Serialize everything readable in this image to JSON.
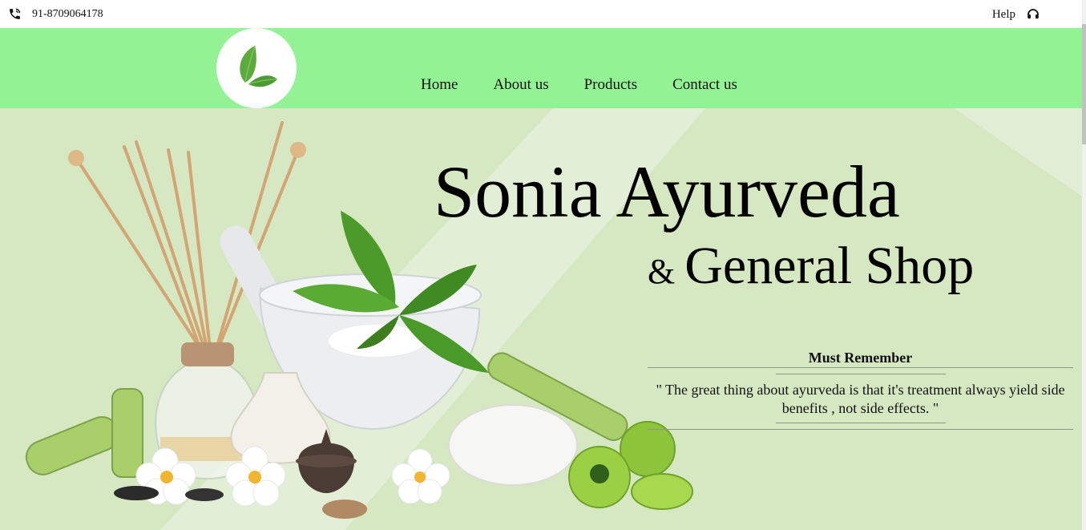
{
  "topbar": {
    "phone_icon": "phone-icon",
    "phone": "91-8709064178",
    "help_label": "Help",
    "help_icon": "headset-icon"
  },
  "logo": {
    "icon": "leaf-icon"
  },
  "nav": {
    "items": [
      {
        "label": "Home"
      },
      {
        "label": "About us"
      },
      {
        "label": "Products"
      },
      {
        "label": "Contact us"
      }
    ]
  },
  "hero": {
    "title": "Sonia Ayurveda",
    "subtitle_amp": "&",
    "subtitle": "General Shop",
    "quote_heading": "Must Remember",
    "quote_text": "\" The great thing about ayurveda is that it's treatment always yield side benefits , not side effects. \""
  },
  "colors": {
    "navbar": "#93f394",
    "hero_bg": "#d5e8c1",
    "leaf": "#5aaa3c"
  }
}
